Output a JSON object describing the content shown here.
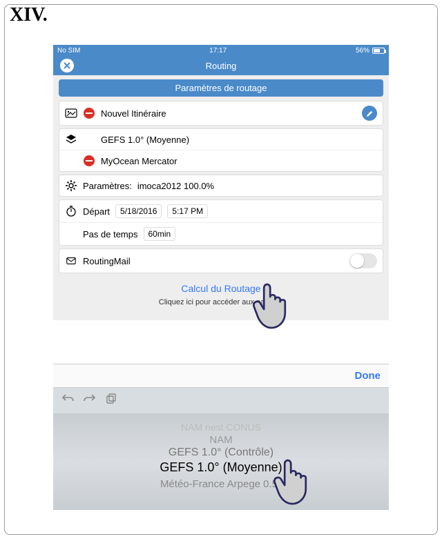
{
  "figure_label": "XIV.",
  "status": {
    "left": "No SIM",
    "time": "17:17",
    "battery_pct": "56%"
  },
  "nav": {
    "title": "Routing"
  },
  "section_header": "Paramètres de routage",
  "route": {
    "name": "Nouvel Itinéraire"
  },
  "models": {
    "primary": "GEFS 1.0° (Moyenne)",
    "ocean": "MyOcean Mercator"
  },
  "params": {
    "label": "Paramètres:",
    "value": "imoca2012 100.0%"
  },
  "departure": {
    "label": "Départ",
    "date": "5/18/2016",
    "time": "5:17 PM"
  },
  "timestep": {
    "label": "Pas de temps",
    "value": "60min"
  },
  "mail": {
    "label": "RoutingMail"
  },
  "action": {
    "calc": "Calcul du Routage",
    "hint": "Cliquez ici pour accéder aux pages d"
  },
  "picker": {
    "done": "Done",
    "items": [
      "NAM nest CONUS",
      "NAM",
      "GEFS 1.0° (Contrôle)",
      "GEFS 1.0° (Moyenne)",
      "Météo-France Arpege 0.5°"
    ]
  }
}
